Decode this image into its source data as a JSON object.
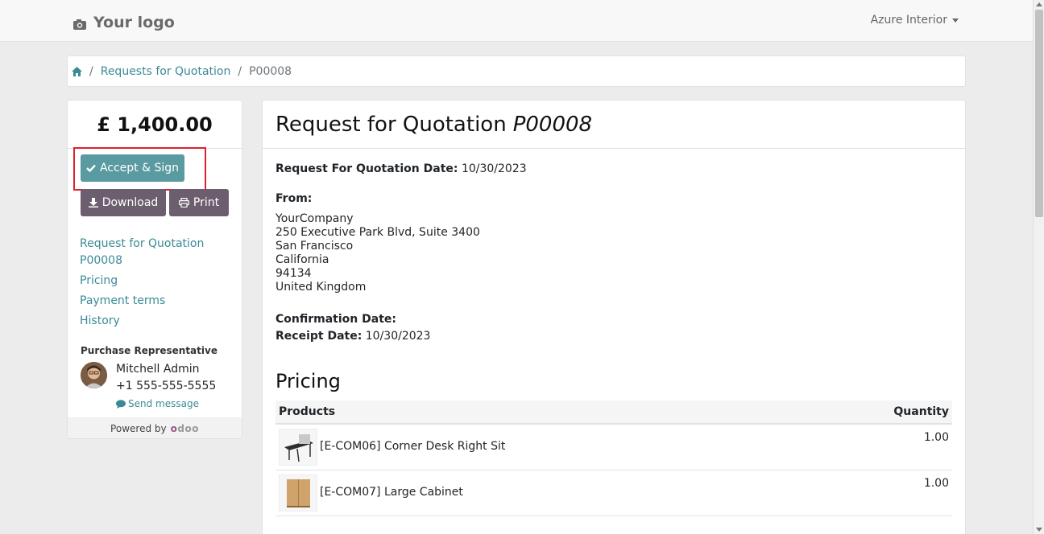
{
  "navbar": {
    "logo_text": "Your logo",
    "company": "Azure Interior"
  },
  "breadcrumb": {
    "items": [
      "Requests for Quotation",
      "P00008"
    ]
  },
  "sidebar": {
    "amount": "£ 1,400.00",
    "accept_label": "Accept & Sign",
    "download_label": "Download",
    "print_label": "Print",
    "toc": [
      "Request for Quotation P00008",
      "Pricing",
      "Payment terms",
      "History"
    ],
    "rep_title": "Purchase Representative",
    "rep_name": "Mitchell Admin",
    "rep_phone": "+1 555-555-5555",
    "send_message": "Send message",
    "powered_by": "Powered by",
    "powered_brand": "odoo"
  },
  "main": {
    "title": "Request for Quotation",
    "ref": "P00008",
    "rfq_date_label": "Request For Quotation Date:",
    "rfq_date": "10/30/2023",
    "from_label": "From:",
    "address": [
      "YourCompany",
      "250 Executive Park Blvd, Suite 3400",
      "San Francisco",
      "California",
      "94134",
      "United Kingdom"
    ],
    "confirmation_label": "Confirmation Date:",
    "receipt_label": "Receipt Date:",
    "receipt_date": "10/30/2023",
    "pricing_title": "Pricing",
    "table": {
      "col_products": "Products",
      "col_quantity": "Quantity",
      "rows": [
        {
          "name": "[E-COM06] Corner Desk Right Sit",
          "qty": "1.00"
        },
        {
          "name": "[E-COM07] Large Cabinet",
          "qty": "1.00"
        }
      ]
    }
  },
  "colors": {
    "accent": "#5a9aa1",
    "secondary": "#6c5e6e",
    "highlight": "#e0202b",
    "link": "#3a8a96"
  }
}
